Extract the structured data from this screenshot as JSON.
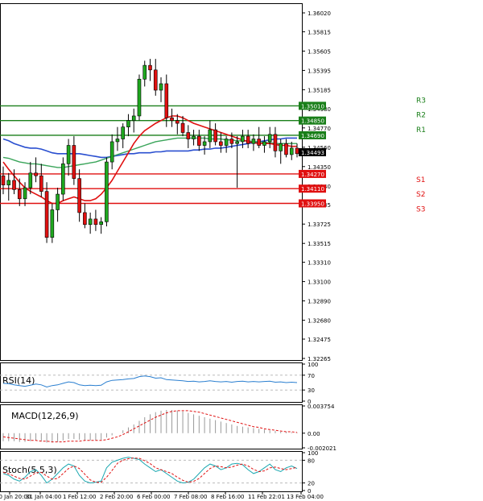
{
  "chart_data": {
    "type": "candlestick",
    "symbol_timeframe": "",
    "y_ticks": [
      "1.36020",
      "1.35815",
      "1.35605",
      "1.35395",
      "1.35185",
      "1.34980",
      "1.34770",
      "1.34560",
      "1.34350",
      "1.34140",
      "1.33935",
      "1.33725",
      "1.33515",
      "1.33310",
      "1.33100",
      "1.32890",
      "1.32680",
      "1.32475",
      "1.32265"
    ],
    "x_ticks": [
      "30 Jan 20:00",
      "31 Jan 04:00",
      "1 Feb 12:00",
      "2 Feb 20:00",
      "6 Feb 00:00",
      "7 Feb 08:00",
      "8 Feb 16:00",
      "11 Feb 22:01",
      "13 Feb 04:00"
    ],
    "price_range": [
      1.32265,
      1.3602
    ],
    "current_price": "1.34493",
    "levels": [
      {
        "name": "R3",
        "value": 1.3501,
        "label": "1.35010",
        "color": "#1a7f1a"
      },
      {
        "name": "R2",
        "value": 1.3485,
        "label": "1.34850",
        "color": "#1a7f1a"
      },
      {
        "name": "R1",
        "value": 1.3469,
        "label": "1.34690",
        "color": "#1a7f1a"
      },
      {
        "name": "S1",
        "value": 1.3427,
        "label": "1.34270",
        "color": "#e01010"
      },
      {
        "name": "S2",
        "value": 1.3411,
        "label": "1.34110",
        "color": "#e01010"
      },
      {
        "name": "S3",
        "value": 1.3395,
        "label": "1.33950",
        "color": "#e01010"
      }
    ],
    "candles": [
      [
        1.3425,
        1.3435,
        1.3405,
        1.3415
      ],
      [
        1.3415,
        1.3428,
        1.3398,
        1.342
      ],
      [
        1.342,
        1.3432,
        1.3405,
        1.341
      ],
      [
        1.341,
        1.3422,
        1.3392,
        1.34
      ],
      [
        1.34,
        1.3418,
        1.3392,
        1.3412
      ],
      [
        1.3412,
        1.344,
        1.3405,
        1.3428
      ],
      [
        1.3428,
        1.3445,
        1.3418,
        1.3425
      ],
      [
        1.3425,
        1.3438,
        1.3402,
        1.3408
      ],
      [
        1.3408,
        1.3418,
        1.3352,
        1.3358
      ],
      [
        1.3358,
        1.3395,
        1.3352,
        1.3388
      ],
      [
        1.3388,
        1.3412,
        1.3375,
        1.3405
      ],
      [
        1.3405,
        1.3445,
        1.3398,
        1.3438
      ],
      [
        1.3438,
        1.3465,
        1.3425,
        1.3458
      ],
      [
        1.3458,
        1.3468,
        1.3415,
        1.3422
      ],
      [
        1.3422,
        1.3432,
        1.3375,
        1.3385
      ],
      [
        1.3385,
        1.3395,
        1.3368,
        1.3372
      ],
      [
        1.3372,
        1.3385,
        1.3362,
        1.3378
      ],
      [
        1.3378,
        1.3388,
        1.3365,
        1.3372
      ],
      [
        1.3372,
        1.338,
        1.3362,
        1.3375
      ],
      [
        1.3375,
        1.3445,
        1.337,
        1.344
      ],
      [
        1.344,
        1.347,
        1.3432,
        1.3462
      ],
      [
        1.3462,
        1.3478,
        1.3452,
        1.3465
      ],
      [
        1.3465,
        1.3482,
        1.3455,
        1.3478
      ],
      [
        1.3478,
        1.3492,
        1.3468,
        1.3485
      ],
      [
        1.3485,
        1.3498,
        1.3472,
        1.349
      ],
      [
        1.349,
        1.3535,
        1.3485,
        1.353
      ],
      [
        1.353,
        1.355,
        1.3522,
        1.3545
      ],
      [
        1.3545,
        1.3552,
        1.3528,
        1.354
      ],
      [
        1.354,
        1.3552,
        1.3512,
        1.3518
      ],
      [
        1.3518,
        1.3532,
        1.3505,
        1.3525
      ],
      [
        1.3525,
        1.3535,
        1.3478,
        1.3488
      ],
      [
        1.3488,
        1.3498,
        1.3478,
        1.3485
      ],
      [
        1.3485,
        1.3492,
        1.347,
        1.3482
      ],
      [
        1.3482,
        1.349,
        1.3468,
        1.3472
      ],
      [
        1.3472,
        1.348,
        1.3455,
        1.3465
      ],
      [
        1.3465,
        1.3475,
        1.3458,
        1.3468
      ],
      [
        1.3468,
        1.3475,
        1.3452,
        1.3458
      ],
      [
        1.3458,
        1.3468,
        1.3448,
        1.3462
      ],
      [
        1.3462,
        1.3485,
        1.3455,
        1.3475
      ],
      [
        1.3475,
        1.3482,
        1.3458,
        1.3462
      ],
      [
        1.3462,
        1.3472,
        1.345,
        1.3458
      ],
      [
        1.3458,
        1.3468,
        1.345,
        1.3465
      ],
      [
        1.3465,
        1.3472,
        1.3455,
        1.346
      ],
      [
        1.346,
        1.3468,
        1.3412,
        1.3462
      ],
      [
        1.3462,
        1.3475,
        1.3455,
        1.3468
      ],
      [
        1.3468,
        1.3475,
        1.3455,
        1.346
      ],
      [
        1.346,
        1.347,
        1.3452,
        1.3465
      ],
      [
        1.3465,
        1.3478,
        1.3455,
        1.3458
      ],
      [
        1.3458,
        1.3468,
        1.345,
        1.3462
      ],
      [
        1.3462,
        1.3478,
        1.3455,
        1.347
      ],
      [
        1.347,
        1.3478,
        1.3445,
        1.3452
      ],
      [
        1.3452,
        1.3465,
        1.3438,
        1.346
      ],
      [
        1.346,
        1.3465,
        1.3445,
        1.3448
      ],
      [
        1.3448,
        1.3462,
        1.3442,
        1.3455
      ],
      [
        1.3455,
        1.346,
        1.3445,
        1.3449
      ]
    ],
    "ma_red": [
      1.344,
      1.3432,
      1.3425,
      1.3418,
      1.3412,
      1.3408,
      1.3405,
      1.3402,
      1.3398,
      1.3395,
      1.3395,
      1.3398,
      1.34,
      1.3402,
      1.34,
      1.3398,
      1.3398,
      1.34,
      1.3405,
      1.3412,
      1.342,
      1.343,
      1.344,
      1.345,
      1.346,
      1.3468,
      1.3474,
      1.3478,
      1.3482,
      1.3485,
      1.3488,
      1.349,
      1.349,
      1.3488,
      1.3485,
      1.3482,
      1.348,
      1.3478,
      1.3476,
      1.3474,
      1.3472,
      1.347,
      1.3468,
      1.3466,
      1.3464,
      1.3462,
      1.3461,
      1.346,
      1.346,
      1.346,
      1.3459,
      1.3458,
      1.3458,
      1.3457,
      1.3457
    ],
    "ma_blue": [
      1.3465,
      1.3463,
      1.346,
      1.3458,
      1.3456,
      1.3455,
      1.3455,
      1.3454,
      1.3452,
      1.345,
      1.3449,
      1.3449,
      1.3449,
      1.3449,
      1.3449,
      1.3448,
      1.3447,
      1.3446,
      1.3445,
      1.3445,
      1.3446,
      1.3447,
      1.3448,
      1.3449,
      1.3449,
      1.345,
      1.345,
      1.345,
      1.3451,
      1.3451,
      1.3452,
      1.3452,
      1.3452,
      1.3452,
      1.3452,
      1.3453,
      1.3453,
      1.3454,
      1.3454,
      1.3455,
      1.3455,
      1.3456,
      1.3457,
      1.3458,
      1.3459,
      1.346,
      1.3461,
      1.3462,
      1.3463,
      1.3464,
      1.3465,
      1.3465,
      1.3466,
      1.3466,
      1.3466
    ],
    "ma_green": [
      1.3445,
      1.3444,
      1.3442,
      1.344,
      1.3439,
      1.3438,
      1.3438,
      1.3437,
      1.3436,
      1.3435,
      1.3434,
      1.3434,
      1.3435,
      1.3436,
      1.3437,
      1.3438,
      1.3439,
      1.344,
      1.3442,
      1.3444,
      1.3446,
      1.3448,
      1.345,
      1.3452,
      1.3454,
      1.3456,
      1.3458,
      1.346,
      1.3462,
      1.3463,
      1.3464,
      1.3465,
      1.3466,
      1.3466,
      1.3466,
      1.3466,
      1.3466,
      1.3466,
      1.3465,
      1.3465,
      1.3465,
      1.3464,
      1.3464,
      1.3463,
      1.3463,
      1.3463,
      1.3462,
      1.3462,
      1.3461,
      1.3461,
      1.346,
      1.346,
      1.346,
      1.346,
      1.346
    ],
    "rsi": {
      "title": "RSI(14)",
      "ticks": [
        "100",
        "70",
        "30",
        "0"
      ],
      "values": [
        48,
        47,
        44,
        42,
        40,
        43,
        46,
        44,
        38,
        42,
        44,
        48,
        52,
        50,
        44,
        42,
        43,
        42,
        43,
        52,
        56,
        57,
        58,
        60,
        61,
        66,
        68,
        66,
        62,
        63,
        58,
        57,
        56,
        55,
        53,
        54,
        52,
        53,
        55,
        53,
        52,
        53,
        51,
        53,
        54,
        52,
        53,
        52,
        53,
        54,
        51,
        52,
        50,
        51,
        50
      ]
    },
    "macd": {
      "title": "MACD(12,26,9)",
      "ticks": [
        "0.003754",
        "0.00",
        "-0.002021"
      ],
      "hist": [
        -0.0011,
        -0.0011,
        -0.0011,
        -0.0012,
        -0.0012,
        -0.0011,
        -0.001,
        -0.0011,
        -0.0013,
        -0.0013,
        -0.0012,
        -0.001,
        -0.0008,
        -0.0008,
        -0.0009,
        -0.001,
        -0.001,
        -0.001,
        -0.0009,
        -0.0006,
        -0.0003,
        0.0,
        0.0004,
        0.0008,
        0.0012,
        0.0017,
        0.0022,
        0.0026,
        0.0029,
        0.0031,
        0.0032,
        0.0032,
        0.0031,
        0.003,
        0.0028,
        0.0026,
        0.0024,
        0.0022,
        0.002,
        0.0018,
        0.0016,
        0.0014,
        0.0012,
        0.001,
        0.0009,
        0.0008,
        0.0007,
        0.0006,
        0.0005,
        0.0004,
        0.0003,
        0.0002,
        0.0002,
        0.0001,
        0.0001
      ],
      "signal": [
        -0.0005,
        -0.0006,
        -0.0007,
        -0.0008,
        -0.0009,
        -0.001,
        -0.001,
        -0.0011,
        -0.0011,
        -0.0012,
        -0.0012,
        -0.0012,
        -0.0011,
        -0.0011,
        -0.0011,
        -0.001,
        -0.001,
        -0.001,
        -0.001,
        -0.0009,
        -0.0007,
        -0.0005,
        -0.0002,
        0.0002,
        0.0006,
        0.001,
        0.0014,
        0.0018,
        0.0022,
        0.0025,
        0.0028,
        0.003,
        0.0031,
        0.0031,
        0.0031,
        0.003,
        0.0029,
        0.0027,
        0.0025,
        0.0023,
        0.0021,
        0.0019,
        0.0017,
        0.0015,
        0.0013,
        0.0011,
        0.0009,
        0.0008,
        0.0006,
        0.0005,
        0.0004,
        0.0003,
        0.0002,
        0.0002,
        0.0001
      ]
    },
    "stoch": {
      "title": "Stoch(5,5,3)",
      "ticks": [
        "100",
        "80",
        "20",
        "0"
      ],
      "k": [
        45,
        40,
        30,
        25,
        35,
        50,
        55,
        40,
        20,
        30,
        45,
        60,
        70,
        65,
        40,
        25,
        20,
        22,
        25,
        60,
        75,
        80,
        85,
        88,
        85,
        82,
        70,
        60,
        50,
        55,
        45,
        35,
        25,
        20,
        22,
        30,
        45,
        60,
        70,
        65,
        55,
        60,
        70,
        72,
        68,
        55,
        45,
        50,
        60,
        70,
        55,
        50,
        60,
        65,
        58
      ],
      "d": [
        48,
        44,
        38,
        32,
        30,
        38,
        47,
        48,
        38,
        30,
        32,
        45,
        58,
        65,
        58,
        43,
        28,
        22,
        22,
        35,
        53,
        72,
        80,
        84,
        86,
        85,
        79,
        71,
        60,
        55,
        50,
        45,
        35,
        27,
        22,
        24,
        32,
        45,
        58,
        65,
        63,
        60,
        62,
        67,
        70,
        65,
        56,
        50,
        52,
        60,
        62,
        58,
        55,
        58,
        61
      ]
    }
  }
}
